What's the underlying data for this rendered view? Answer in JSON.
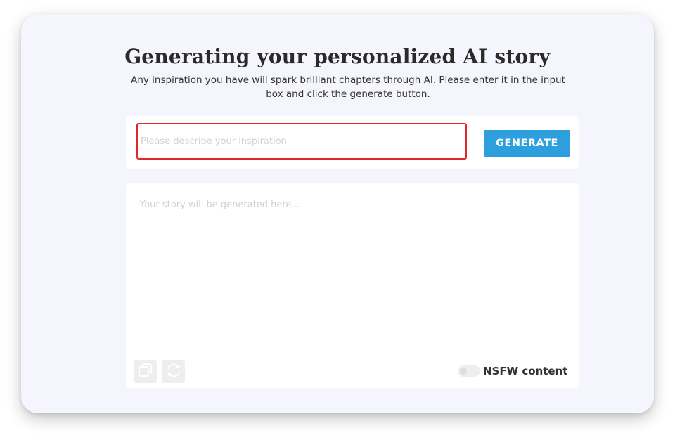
{
  "page": {
    "title": "Generating your personalized AI story",
    "subtitle": "Any inspiration you have will spark brilliant chapters through AI. Please enter it in the input box and click the generate button."
  },
  "input": {
    "placeholder": "Please describe your inspiration",
    "value": ""
  },
  "generate_button": {
    "label": "GENERATE",
    "color": "#2d9fdc"
  },
  "output": {
    "placeholder": "Your story will be generated here...",
    "value": ""
  },
  "tools": {
    "copy_icon": "copy-icon",
    "refresh_icon": "refresh-icon"
  },
  "nsfw_toggle": {
    "label": "NSFW content",
    "enabled": false
  },
  "colors": {
    "highlight_border": "#e3262a",
    "card_background": "#f5f5fd"
  }
}
